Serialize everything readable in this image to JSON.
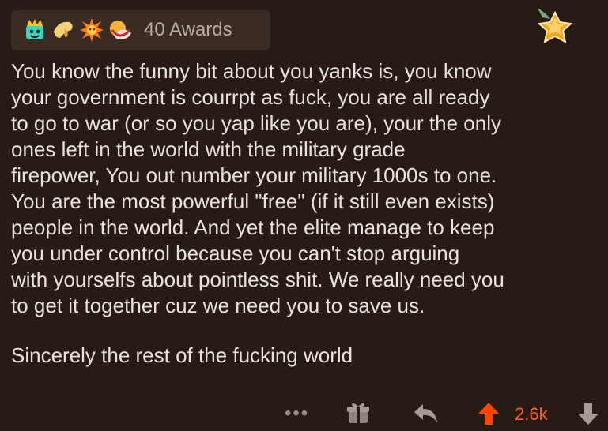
{
  "awards": {
    "icons": [
      "crown-award-icon",
      "praying-hand-award-icon",
      "explosion-award-icon",
      "hugging-award-icon"
    ],
    "count_label": "40 Awards"
  },
  "comment": {
    "body": "You know the funny bit about you yanks is, you know\nyour government is courrpt as fuck, you are all ready\nto go to war (or so you yap like you are), your the only\nones left in the world with the military grade\nfirepower, You out number your military 1000s to one.\nYou are the most powerful \"free\" (if it still even exists)\npeople in the world. And yet the elite manage to keep\nyou under control because you can't stop arguing\nwith yourselfs about pointless shit. We really need you\nto get it together cuz we need you to save us.",
    "signature": "Sincerely the rest of the fucking world"
  },
  "actions": {
    "more_label": "•••",
    "score": "2.6k",
    "upvote_color": "#ff4500"
  }
}
